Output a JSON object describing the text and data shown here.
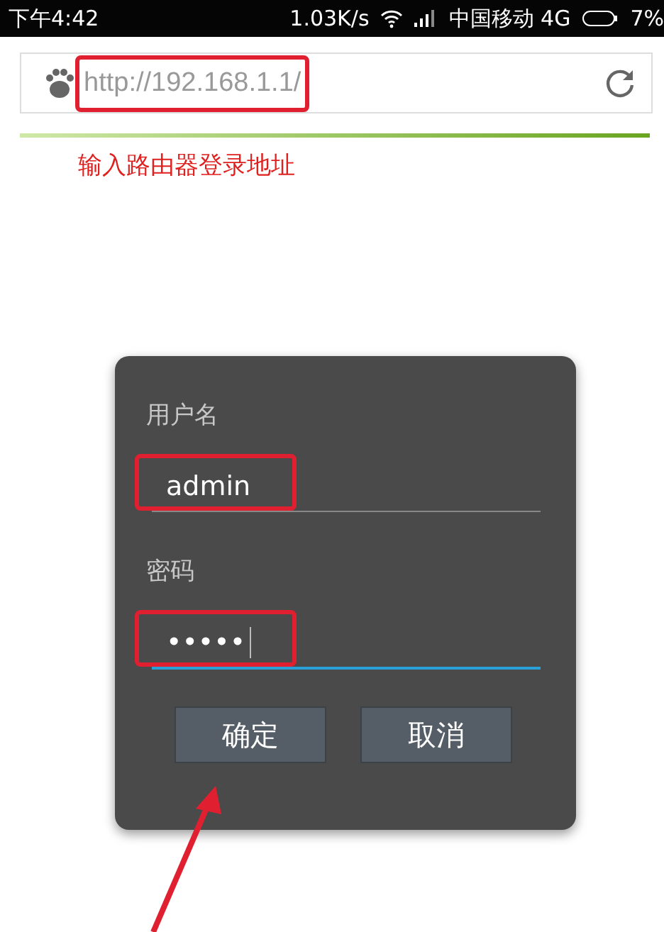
{
  "status_bar": {
    "time": "下午4:42",
    "speed": "1.03K/s",
    "carrier": "中国移动 4G",
    "battery": "7%"
  },
  "address_bar": {
    "url": "http://192.168.1.1/",
    "level": 1
  },
  "annotation": {
    "caption": "输入路由器登录地址"
  },
  "login_dialog": {
    "fields": [
      {
        "label": "用户名",
        "value": "admin",
        "focused": false
      },
      {
        "label": "密码",
        "value": "•••••",
        "focused": true
      }
    ],
    "buttons": [
      "确定",
      "取消"
    ]
  }
}
